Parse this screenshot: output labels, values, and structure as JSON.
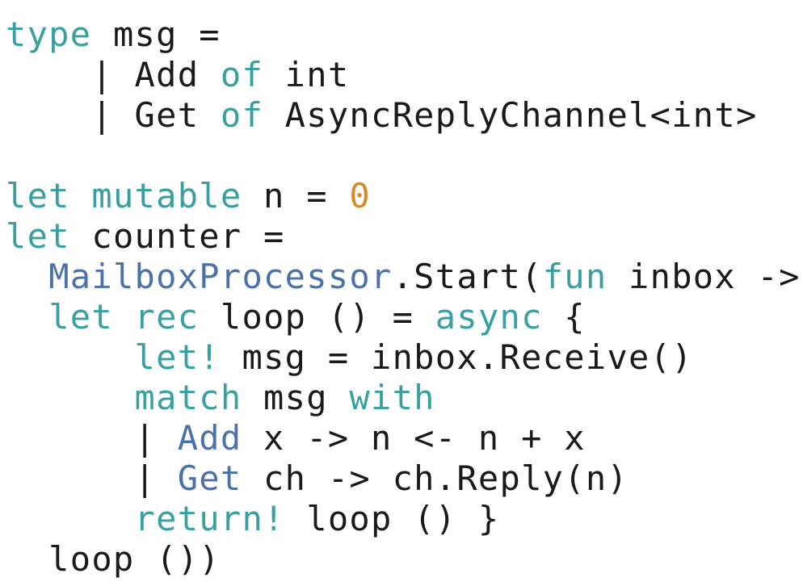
{
  "colors": {
    "keyword": "#3a9fa0",
    "type_or_constructor": "#4a72a8",
    "number": "#d88a2b",
    "text": "#1a1a1a",
    "background": "#ffffff"
  },
  "code_lines": [
    [
      {
        "t": "type",
        "c": "kw"
      },
      {
        "t": " msg =",
        "c": "plain"
      }
    ],
    [
      {
        "t": "    | Add ",
        "c": "plain"
      },
      {
        "t": "of",
        "c": "kw"
      },
      {
        "t": " int",
        "c": "plain"
      }
    ],
    [
      {
        "t": "    | Get ",
        "c": "plain"
      },
      {
        "t": "of",
        "c": "kw"
      },
      {
        "t": " AsyncReplyChannel<int>",
        "c": "plain"
      }
    ],
    [
      {
        "t": "",
        "c": "plain"
      }
    ],
    [
      {
        "t": "let",
        "c": "kw"
      },
      {
        "t": " ",
        "c": "plain"
      },
      {
        "t": "mutable",
        "c": "kw"
      },
      {
        "t": " n = ",
        "c": "plain"
      },
      {
        "t": "0",
        "c": "num"
      }
    ],
    [
      {
        "t": "let",
        "c": "kw"
      },
      {
        "t": " counter =",
        "c": "plain"
      }
    ],
    [
      {
        "t": "  ",
        "c": "plain"
      },
      {
        "t": "MailboxProcessor",
        "c": "ty"
      },
      {
        "t": ".Start(",
        "c": "plain"
      },
      {
        "t": "fun",
        "c": "kw"
      },
      {
        "t": " inbox ->",
        "c": "plain"
      }
    ],
    [
      {
        "t": "  ",
        "c": "plain"
      },
      {
        "t": "let",
        "c": "kw"
      },
      {
        "t": " ",
        "c": "plain"
      },
      {
        "t": "rec",
        "c": "kw"
      },
      {
        "t": " loop () = ",
        "c": "plain"
      },
      {
        "t": "async",
        "c": "kw"
      },
      {
        "t": " {",
        "c": "plain"
      }
    ],
    [
      {
        "t": "      ",
        "c": "plain"
      },
      {
        "t": "let!",
        "c": "kw"
      },
      {
        "t": " msg = inbox.Receive()",
        "c": "plain"
      }
    ],
    [
      {
        "t": "      ",
        "c": "plain"
      },
      {
        "t": "match",
        "c": "kw"
      },
      {
        "t": " msg ",
        "c": "plain"
      },
      {
        "t": "with",
        "c": "kw"
      }
    ],
    [
      {
        "t": "      | ",
        "c": "plain"
      },
      {
        "t": "Add",
        "c": "ty"
      },
      {
        "t": " x -> n <- n + x",
        "c": "plain"
      }
    ],
    [
      {
        "t": "      | ",
        "c": "plain"
      },
      {
        "t": "Get",
        "c": "ty"
      },
      {
        "t": " ch -> ch.Reply(n)",
        "c": "plain"
      }
    ],
    [
      {
        "t": "      ",
        "c": "plain"
      },
      {
        "t": "return!",
        "c": "kw"
      },
      {
        "t": " loop () }",
        "c": "plain"
      }
    ],
    [
      {
        "t": "  loop ())",
        "c": "plain"
      }
    ]
  ]
}
